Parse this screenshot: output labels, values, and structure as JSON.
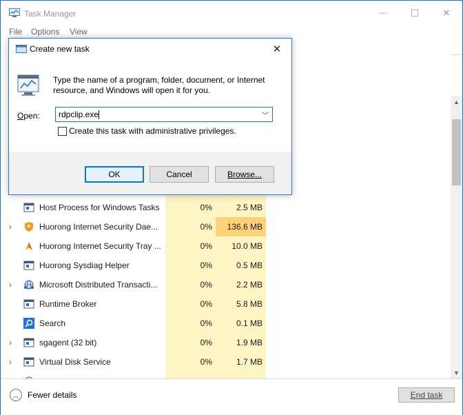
{
  "window": {
    "title": "Task Manager",
    "controls": {
      "minimize": "—",
      "maximize": "☐",
      "close": "✕"
    }
  },
  "menu": {
    "file": "File",
    "options": "Options",
    "view": "View"
  },
  "processes": [
    {
      "name": "Host Process for Windows Tasks",
      "cpu": "0%",
      "memory": "2.5 MB",
      "expandable": false,
      "icon": "service-window-icon"
    },
    {
      "name": "Huorong Internet Security Dae...",
      "cpu": "0%",
      "memory": "136.6 MB",
      "expandable": true,
      "highlight": true,
      "icon": "huorong-shield-icon"
    },
    {
      "name": "Huorong Internet Security Tray ...",
      "cpu": "0%",
      "memory": "10.0 MB",
      "expandable": false,
      "icon": "huorong-tray-icon"
    },
    {
      "name": "Huorong Sysdiag Helper",
      "cpu": "0%",
      "memory": "0.5 MB",
      "expandable": false,
      "icon": "service-window-icon"
    },
    {
      "name": "Microsoft Distributed Transacti...",
      "cpu": "0%",
      "memory": "2.2 MB",
      "expandable": true,
      "icon": "network-globe-icon"
    },
    {
      "name": "Runtime Broker",
      "cpu": "0%",
      "memory": "5.8 MB",
      "expandable": false,
      "icon": "service-window-icon"
    },
    {
      "name": "Search",
      "cpu": "0%",
      "memory": "0.1 MB",
      "expandable": false,
      "icon": "search-icon"
    },
    {
      "name": "sgagent (32 bit)",
      "cpu": "0%",
      "memory": "1.9 MB",
      "expandable": true,
      "icon": "service-window-icon"
    },
    {
      "name": "Virtual Disk Service",
      "cpu": "0%",
      "memory": "1.7 MB",
      "expandable": true,
      "icon": "service-window-icon"
    }
  ],
  "footer": {
    "fewer_details": "Fewer details",
    "end_task": "End task"
  },
  "dialog": {
    "title": "Create new task",
    "prompt": "Type the name of a program, folder, document, or Internet resource, and Windows will open it for you.",
    "open_label": "Open:",
    "open_value": "rdpclip.exe",
    "admin_label": "Create this task with administrative privileges.",
    "admin_checked": false,
    "ok": "OK",
    "cancel": "Cancel",
    "browse": "Browse..."
  },
  "colors": {
    "accent": "#0078d7",
    "cpu_column": "#fff4c4",
    "memory_highlight": "#ffd27a",
    "desktop": "#0b5bb8"
  }
}
